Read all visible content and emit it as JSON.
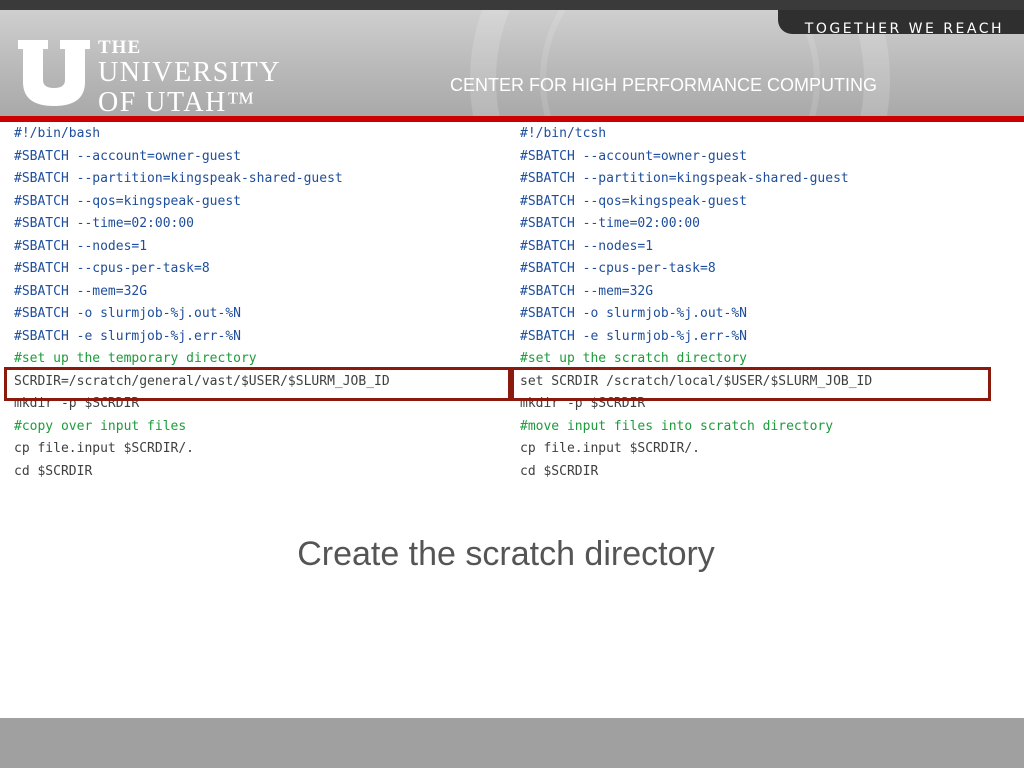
{
  "header": {
    "tagline": "TOGETHER WE REACH",
    "logo": {
      "icon": "block-u-logo-icon",
      "line1": "THE",
      "line2": "UNIVERSITY",
      "line3": "OF UTAH™"
    },
    "center_name": "CENTER FOR HIGH PERFORMANCE COMPUTING"
  },
  "scripts": {
    "left": [
      {
        "text": "#!/bin/bash",
        "kind": "directive"
      },
      {
        "text": "#SBATCH --account=owner-guest",
        "kind": "directive"
      },
      {
        "text": "#SBATCH --partition=kingspeak-shared-guest",
        "kind": "directive"
      },
      {
        "text": "#SBATCH --qos=kingspeak-guest",
        "kind": "directive"
      },
      {
        "text": "#SBATCH --time=02:00:00",
        "kind": "directive"
      },
      {
        "text": "#SBATCH --nodes=1",
        "kind": "directive"
      },
      {
        "text": "#SBATCH --cpus-per-task=8",
        "kind": "directive"
      },
      {
        "text": "#SBATCH --mem=32G",
        "kind": "directive"
      },
      {
        "text": "#SBATCH -o slurmjob-%j.out-%N",
        "kind": "directive"
      },
      {
        "text": "#SBATCH -e slurmjob-%j.err-%N",
        "kind": "directive"
      },
      {
        "text": "#set up the temporary directory",
        "kind": "comment"
      },
      {
        "text": "SCRDIR=/scratch/general/vast/$USER/$SLURM_JOB_ID",
        "kind": "plain"
      },
      {
        "text": "mkdir -p $SCRDIR",
        "kind": "plain"
      },
      {
        "text": "#copy over input files",
        "kind": "comment"
      },
      {
        "text": "cp file.input $SCRDIR/.",
        "kind": "plain"
      },
      {
        "text": "cd $SCRDIR",
        "kind": "plain"
      }
    ],
    "right": [
      {
        "text": "#!/bin/tcsh",
        "kind": "directive"
      },
      {
        "text": "#SBATCH --account=owner-guest",
        "kind": "directive"
      },
      {
        "text": "#SBATCH --partition=kingspeak-shared-guest",
        "kind": "directive"
      },
      {
        "text": "#SBATCH --qos=kingspeak-guest",
        "kind": "directive"
      },
      {
        "text": "#SBATCH --time=02:00:00",
        "kind": "directive"
      },
      {
        "text": "#SBATCH --nodes=1",
        "kind": "directive"
      },
      {
        "text": "#SBATCH --cpus-per-task=8",
        "kind": "directive"
      },
      {
        "text": "#SBATCH --mem=32G",
        "kind": "directive"
      },
      {
        "text": "#SBATCH -o slurmjob-%j.out-%N",
        "kind": "directive"
      },
      {
        "text": "#SBATCH -e slurmjob-%j.err-%N",
        "kind": "directive"
      },
      {
        "text": "#set up the scratch directory",
        "kind": "comment"
      },
      {
        "text": "set SCRDIR /scratch/local/$USER/$SLURM_JOB_ID",
        "kind": "plain"
      },
      {
        "text": "mkdir -p $SCRDIR",
        "kind": "plain"
      },
      {
        "text": "#move input files into scratch directory",
        "kind": "comment"
      },
      {
        "text": "cp file.input $SCRDIR/.",
        "kind": "plain"
      },
      {
        "text": "cd $SCRDIR",
        "kind": "plain"
      }
    ],
    "highlighted_line": 11
  },
  "caption": "Create the scratch directory",
  "colors": {
    "directive": "#1f4e9c",
    "comment": "#1e9b3c",
    "plain": "#404040",
    "highlight_border": "#8b1a0e",
    "accent_red": "#cc0000"
  }
}
